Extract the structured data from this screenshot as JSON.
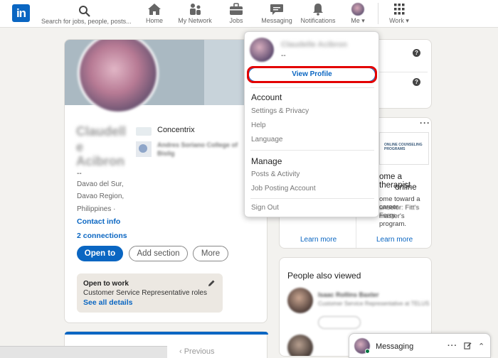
{
  "nav": {
    "search_placeholder": "Search for jobs, people, posts...",
    "items": [
      "Home",
      "My Network",
      "Jobs",
      "Messaging",
      "Notifications",
      "Me",
      "Work"
    ]
  },
  "profile": {
    "name_line1": "Claudell",
    "name_line2": "e",
    "name_line3": "Acibron",
    "dash": "--",
    "location1": "Davao del Sur,",
    "location2": "Davao Region,",
    "location3": "Philippines ·",
    "contact_info": "Contact info",
    "connections": "2 connections",
    "company": "Concentrix",
    "school_line1": "Andres Soriano College of",
    "school_line2": "Bislig",
    "btn_open_to": "Open to",
    "btn_add_section": "Add section",
    "btn_more": "More",
    "open_to_work": {
      "title": "Open to work",
      "roles": "Customer Service Representative roles",
      "see_all": "See all details"
    }
  },
  "dropdown": {
    "name": "Claudelle Acibron",
    "dash": "--",
    "view_profile": "View Profile",
    "account_head": "Account",
    "account_items": [
      "Settings & Privacy",
      "Help",
      "Language"
    ],
    "manage_head": "Manage",
    "manage_items": [
      "Posts & Activity",
      "Job Posting Account"
    ],
    "sign_out": "Sign Out"
  },
  "right": {
    "ad_headline1": "ome a therapist",
    "ad_headline2": "online",
    "ad_body1": "ome toward a career",
    "ad_body2": "unselor: Fitt's Ferry",
    "ad_body3": "master's program.",
    "ad_logo_text": "ONLINE COUNSELING PROGRAMS",
    "learn_more": "Learn more",
    "people_also_viewed": "People also viewed",
    "person_name": "Isaac Rollins Baxter",
    "person_title": "Customer Service Representative at TELUS"
  },
  "messaging": {
    "label": "Messaging"
  },
  "footer": {
    "previous": "‹ Previous"
  },
  "colors": {
    "brand": "#0a66c2",
    "highlight": "#e30000"
  }
}
